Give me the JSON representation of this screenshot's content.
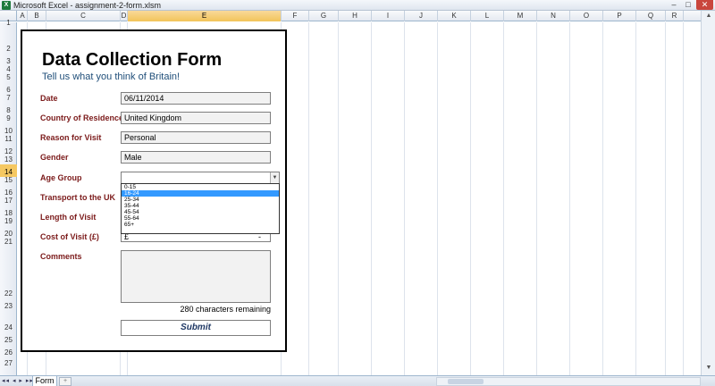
{
  "window": {
    "title": "Microsoft Excel - assignment-2-form.xlsm",
    "app_icon": "excel-icon",
    "controls": {
      "minimize": "–",
      "maximize": "□",
      "close": "✕"
    }
  },
  "columns": [
    "A",
    "B",
    "C",
    "D",
    "E",
    "F",
    "G",
    "H",
    "I",
    "J",
    "K",
    "L",
    "M",
    "N",
    "O",
    "P",
    "Q",
    "R"
  ],
  "active_column": "E",
  "rows": [
    "1",
    "2",
    "3",
    "4",
    "5",
    "6",
    "7",
    "8",
    "9",
    "10",
    "11",
    "12",
    "13",
    "14",
    "15",
    "16",
    "17",
    "18",
    "19",
    "20",
    "21",
    "22",
    "23",
    "24",
    "25",
    "26",
    "27"
  ],
  "active_row": "14",
  "form": {
    "title": "Data Collection Form",
    "subtitle": "Tell us what you think of Britain!",
    "fields": {
      "date": {
        "label": "Date",
        "value": "06/11/2014"
      },
      "country": {
        "label": "Country of Residence",
        "value": "United Kingdom"
      },
      "reason": {
        "label": "Reason for Visit",
        "value": "Personal"
      },
      "gender": {
        "label": "Gender",
        "value": "Male"
      },
      "age": {
        "label": "Age Group",
        "value": ""
      },
      "transport": {
        "label": "Transport to the UK"
      },
      "length": {
        "label": "Length of Visit"
      },
      "cost": {
        "label": "Cost of Visit (£)",
        "value": "£",
        "suffix": "-"
      },
      "comments": {
        "label": "Comments"
      }
    },
    "age_options": [
      "0-15",
      "16-24",
      "25-34",
      "35-44",
      "45-54",
      "55-64",
      "65+"
    ],
    "age_highlighted": "16-24",
    "chars_remaining": "280 characters remaining",
    "submit_label": "Submit"
  },
  "sheet": {
    "nav_buttons": "◂◂ ◂ ▸ ▸▸",
    "tab": "Form",
    "new_sheet_icon": "new-sheet-icon"
  },
  "colors": {
    "label": "#7b1a1a",
    "subtitle": "#1f4e79",
    "highlight": "#3399ff",
    "active_header": "#f5c862"
  }
}
